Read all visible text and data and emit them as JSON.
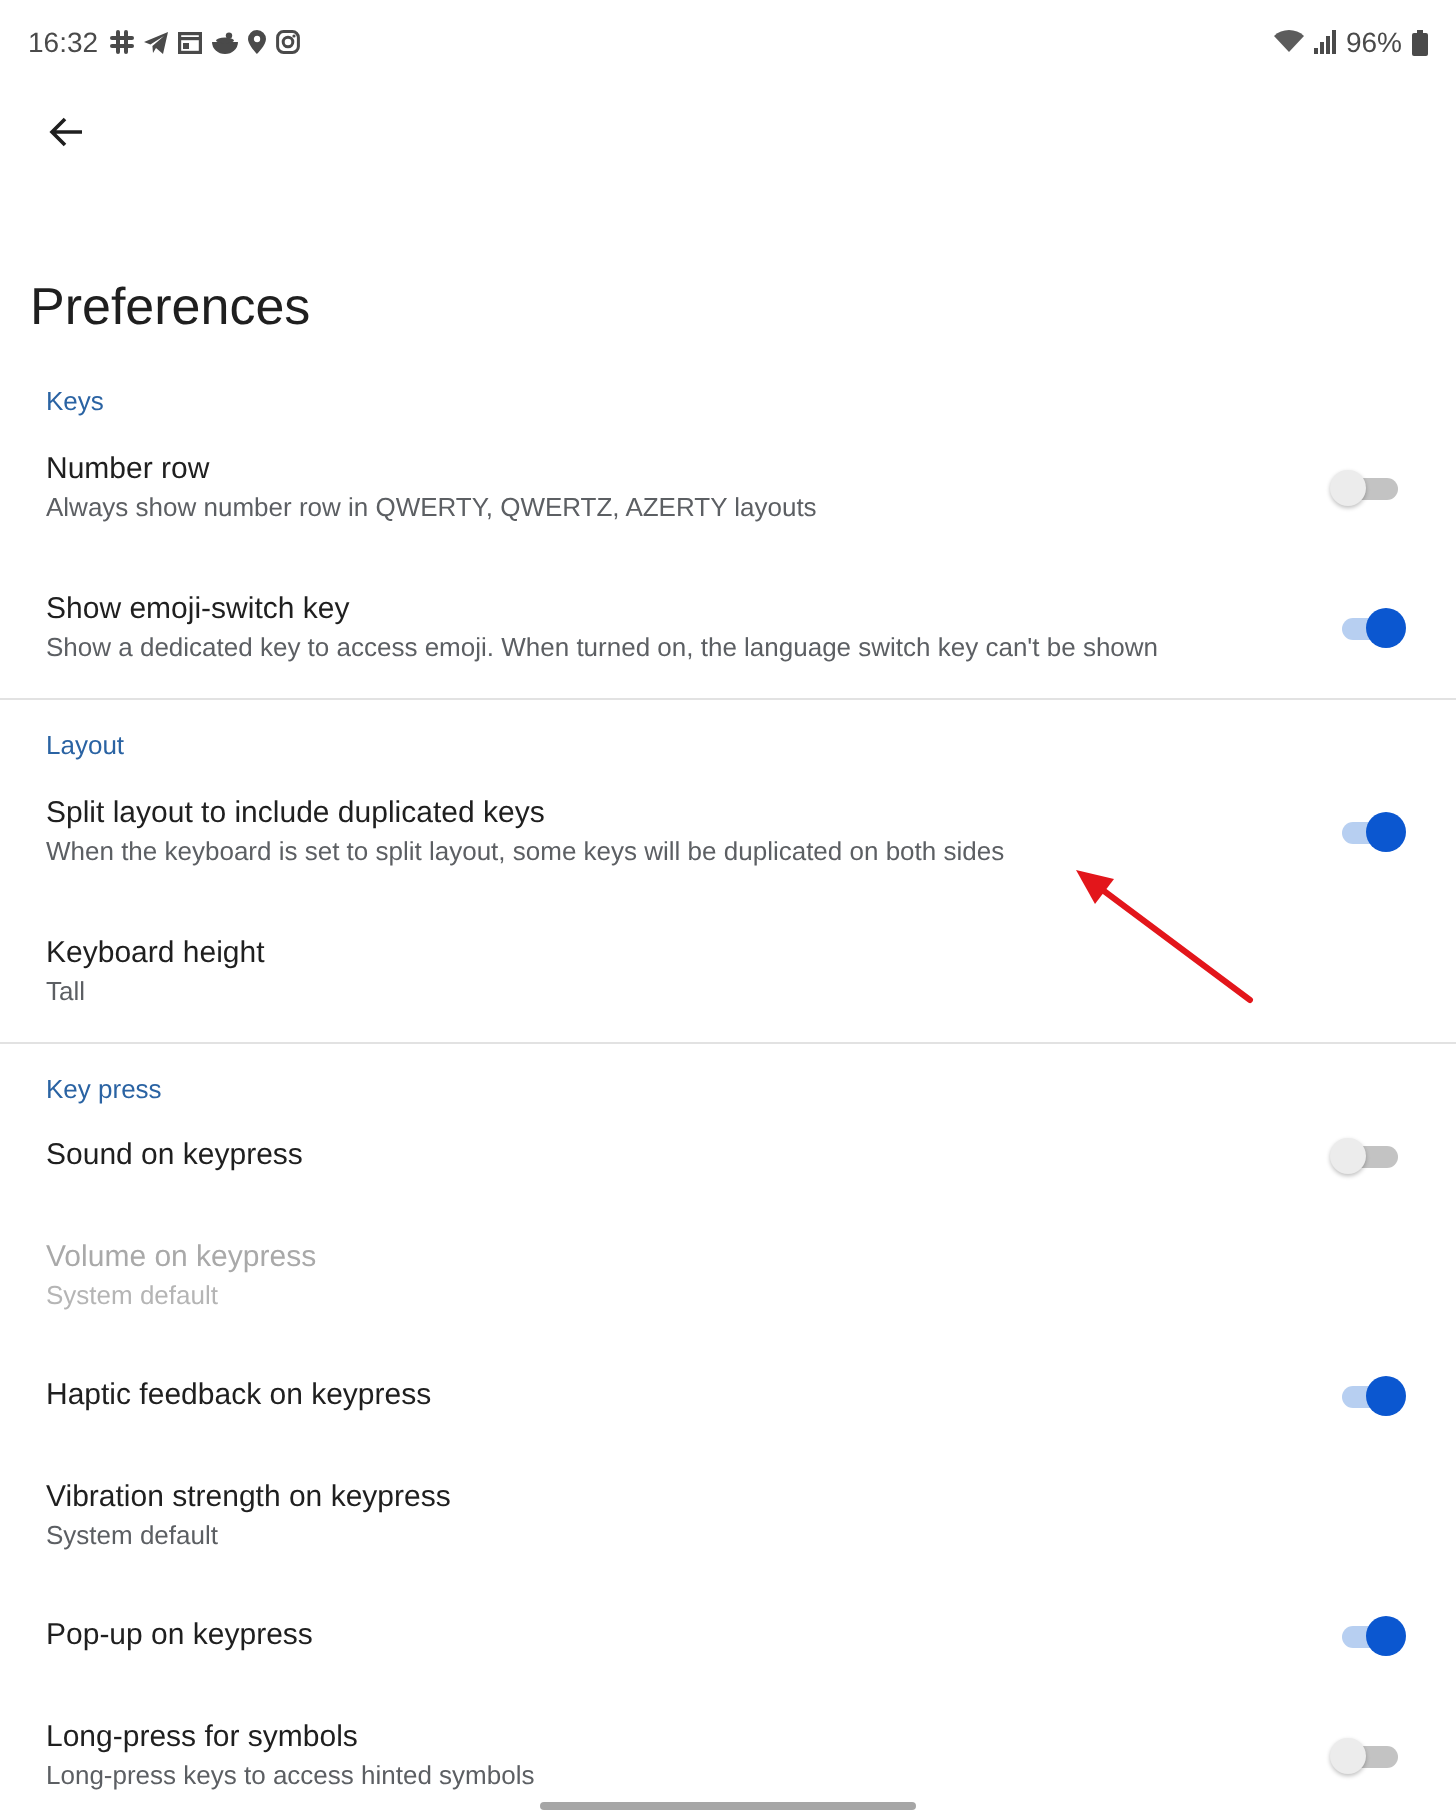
{
  "status_bar": {
    "time": "16:32",
    "battery": "96%"
  },
  "app_bar": {
    "title": "Preferences"
  },
  "sections": [
    {
      "header": "Keys",
      "items": [
        {
          "kind": "toggle",
          "title": "Number row",
          "subtitle": "Always show number row in QWERTY, QWERTZ, AZERTY layouts",
          "on": false,
          "disabled": false
        },
        {
          "kind": "toggle",
          "title": "Show emoji-switch key",
          "subtitle": "Show a dedicated key to access emoji. When turned on, the language switch key can't be shown",
          "on": true,
          "disabled": false
        }
      ]
    },
    {
      "header": "Layout",
      "items": [
        {
          "kind": "toggle",
          "title": "Split layout to include duplicated keys",
          "subtitle": "When the keyboard is set to split layout, some keys will be duplicated on both sides",
          "on": true,
          "disabled": false
        },
        {
          "kind": "value",
          "title": "Keyboard height",
          "subtitle": "Tall",
          "disabled": false
        }
      ]
    },
    {
      "header": "Key press",
      "items": [
        {
          "kind": "toggle",
          "title": "Sound on keypress",
          "on": false,
          "disabled": false
        },
        {
          "kind": "value",
          "title": "Volume on keypress",
          "subtitle": "System default",
          "disabled": true
        },
        {
          "kind": "toggle",
          "title": "Haptic feedback on keypress",
          "on": true,
          "disabled": false
        },
        {
          "kind": "value",
          "title": "Vibration strength on keypress",
          "subtitle": "System default",
          "disabled": false
        },
        {
          "kind": "toggle",
          "title": "Pop-up on keypress",
          "on": true,
          "disabled": false
        },
        {
          "kind": "toggle",
          "title": "Long-press for symbols",
          "subtitle": "Long-press keys to access hinted symbols",
          "on": false,
          "disabled": false
        }
      ]
    }
  ],
  "annotations": [
    {
      "kind": "arrow"
    }
  ]
}
